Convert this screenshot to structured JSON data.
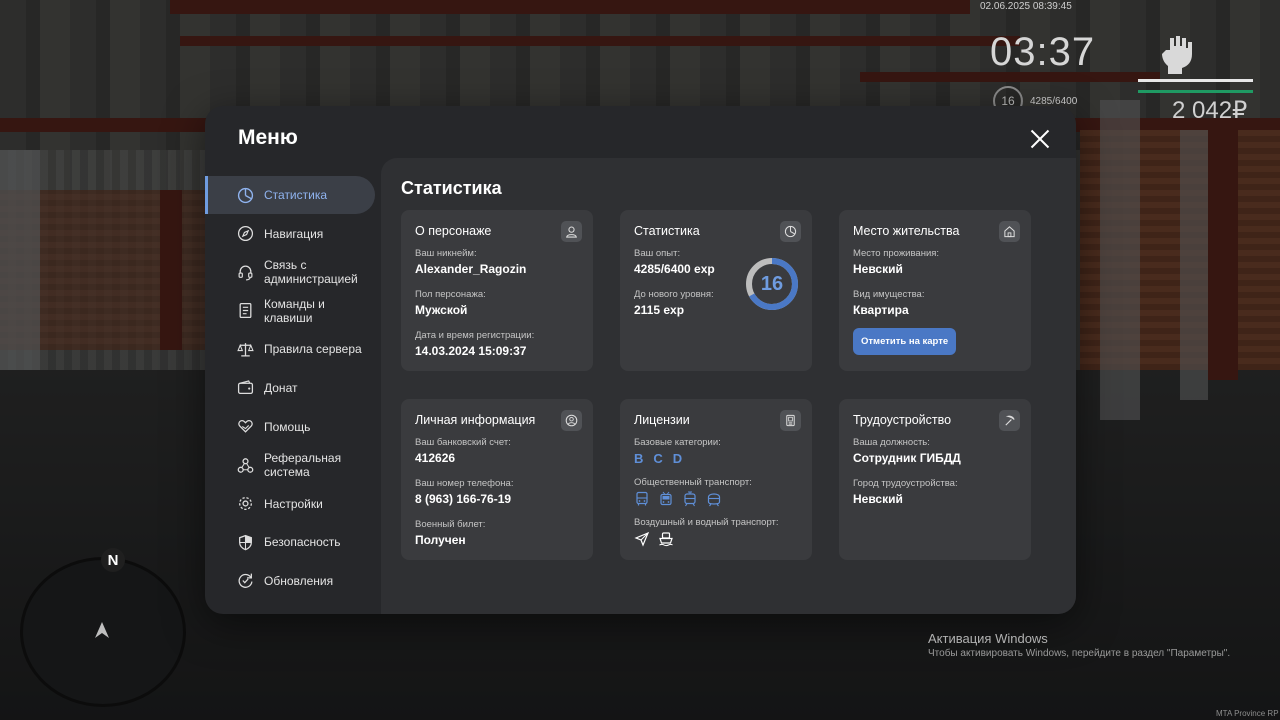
{
  "hud": {
    "datetime": "02.06.2025 08:39:45",
    "time": "03:37",
    "level": "16",
    "exp": "4285/6400",
    "money": "2 042₽",
    "health_color": "#e7e7e7",
    "armor_color": "#1f9a63"
  },
  "minimap": {
    "north_label": "N"
  },
  "menu": {
    "title": "Меню",
    "sidebar": [
      {
        "label": "Статистика",
        "icon": "stats-icon",
        "active": true
      },
      {
        "label": "Навигация",
        "icon": "compass-icon"
      },
      {
        "label": "Связь с администрацией",
        "icon": "headset-icon"
      },
      {
        "label": "Команды и клавиши",
        "icon": "document-icon"
      },
      {
        "label": "Правила сервера",
        "icon": "scales-icon"
      },
      {
        "label": "Донат",
        "icon": "wallet-icon"
      },
      {
        "label": "Помощь",
        "icon": "heart-hands-icon"
      },
      {
        "label": "Реферальная система",
        "icon": "referral-icon"
      },
      {
        "label": "Настройки",
        "icon": "gear-icon"
      },
      {
        "label": "Безопасность",
        "icon": "shield-icon"
      },
      {
        "label": "Обновления",
        "icon": "update-icon"
      }
    ],
    "page_title": "Статистика",
    "cards": {
      "character": {
        "title": "О персонаже",
        "nickname_label": "Ваш никнейм:",
        "nickname": "Alexander_Ragozin",
        "gender_label": "Пол персонажа:",
        "gender": "Мужской",
        "reg_label": "Дата и время регистрации:",
        "reg_value": "14.03.2024 15:09:37"
      },
      "stats": {
        "title": "Статистика",
        "exp_label": "Ваш опыт:",
        "exp_value": "4285/6400 exp",
        "next_label": "До нового уровня:",
        "next_value": "2115 exp",
        "level": "16",
        "progress": 0.67,
        "accent": "#4a78c5"
      },
      "residence": {
        "title": "Место жительства",
        "place_label": "Место проживания:",
        "place_value": "Невский",
        "property_label": "Вид имущества:",
        "property_value": "Квартира",
        "map_button": "Отметить на карте"
      },
      "personal": {
        "title": "Личная информация",
        "bank_label": "Ваш банковский счет:",
        "bank_value": "412626",
        "phone_label": "Ваш номер телефона:",
        "phone_value": "8 (963) 166-76-19",
        "military_label": "Военный билет:",
        "military_value": "Получен"
      },
      "licenses": {
        "title": "Лицензии",
        "basic_label": "Базовые категории:",
        "categories": [
          "B",
          "C",
          "D"
        ],
        "public_label": "Общественный транспорт:",
        "public_icons": [
          "bus-icon",
          "trolleybus-icon",
          "tram-icon",
          "metro-icon"
        ],
        "air_water_label": "Воздушный и водный транспорт:",
        "air_water_icons": [
          "plane-icon",
          "boat-icon"
        ]
      },
      "employment": {
        "title": "Трудоустройство",
        "position_label": "Ваша должность:",
        "position_value": "Сотрудник ГИБДД",
        "city_label": "Город трудоустройства:",
        "city_value": "Невский"
      }
    }
  },
  "watermark": {
    "title": "Активация Windows",
    "subtitle": "Чтобы активировать Windows, перейдите в раздел \"Параметры\".",
    "mta": "MTA Province RP"
  }
}
